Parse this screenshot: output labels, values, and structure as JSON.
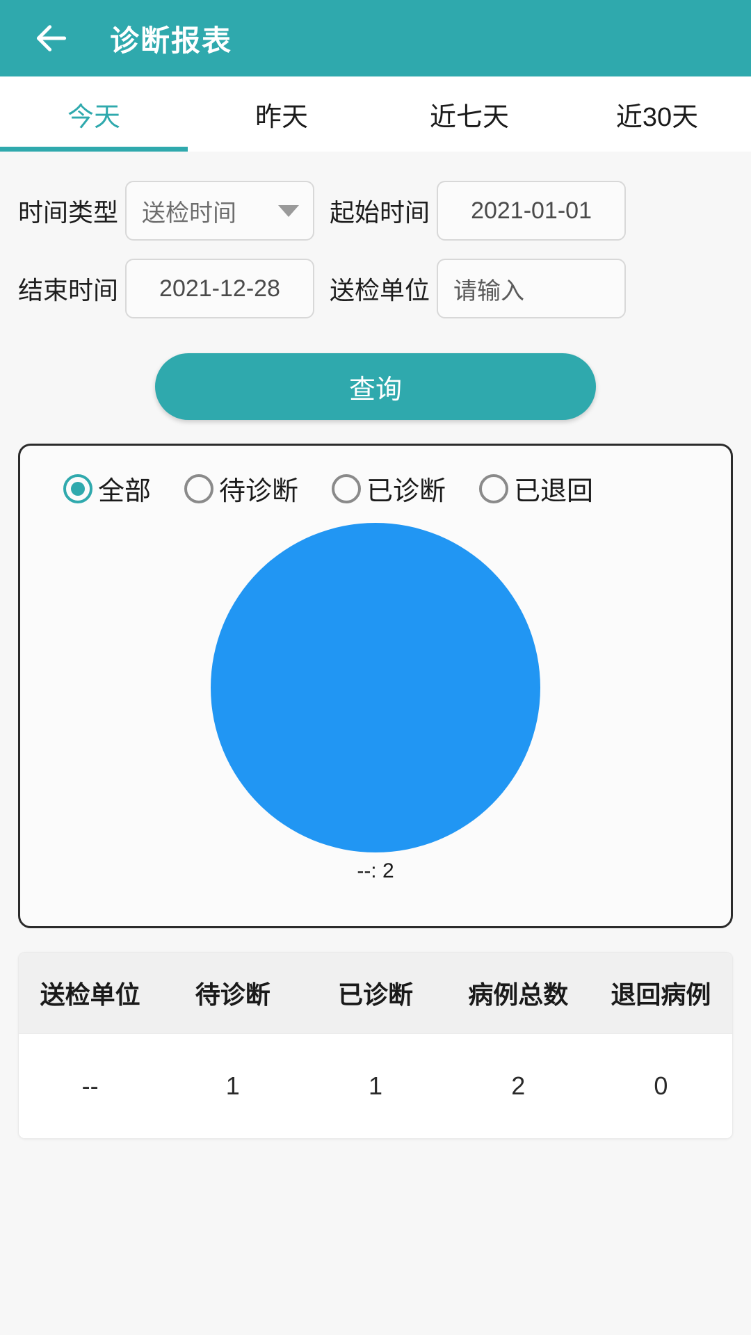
{
  "appbar": {
    "back_icon": "arrow-left-icon",
    "title": "诊断报表",
    "background": "#2fa9ad"
  },
  "tabs": {
    "active_index": 0,
    "items": [
      {
        "label": "今天"
      },
      {
        "label": "昨天"
      },
      {
        "label": "近七天"
      },
      {
        "label": "近30天"
      }
    ],
    "active_color": "#2fa9ad",
    "inactive_color": "#1a1a1a"
  },
  "form": {
    "time_type": {
      "label": "时间类型",
      "value": "送检时间",
      "caret_icon": "chevron-down-icon"
    },
    "start_time": {
      "label": "起始时间",
      "value": "2021-01-01"
    },
    "end_time": {
      "label": "结束时间",
      "value": "2021-12-28"
    },
    "hospital": {
      "label": "送检单位",
      "value": "",
      "placeholder": "请输入"
    },
    "query_button": "查询"
  },
  "status_filter": {
    "selected_index": 0,
    "options": [
      {
        "label": "全部"
      },
      {
        "label": "待诊断"
      },
      {
        "label": "已诊断"
      },
      {
        "label": "已退回"
      }
    ],
    "accent": "#2fa9ad"
  },
  "chart_data": {
    "type": "pie",
    "title": "",
    "categories": [
      "--"
    ],
    "values": [
      2
    ],
    "colors": [
      "#2196f3"
    ],
    "labels": [
      "--: 2"
    ],
    "label_position": "bottom",
    "legend": "none",
    "total": 2
  },
  "table": {
    "columns": [
      "送检单位",
      "待诊断",
      "已诊断",
      "病例总数",
      "退回病例"
    ],
    "rows": [
      [
        "--",
        "1",
        "1",
        "2",
        "0"
      ]
    ]
  }
}
